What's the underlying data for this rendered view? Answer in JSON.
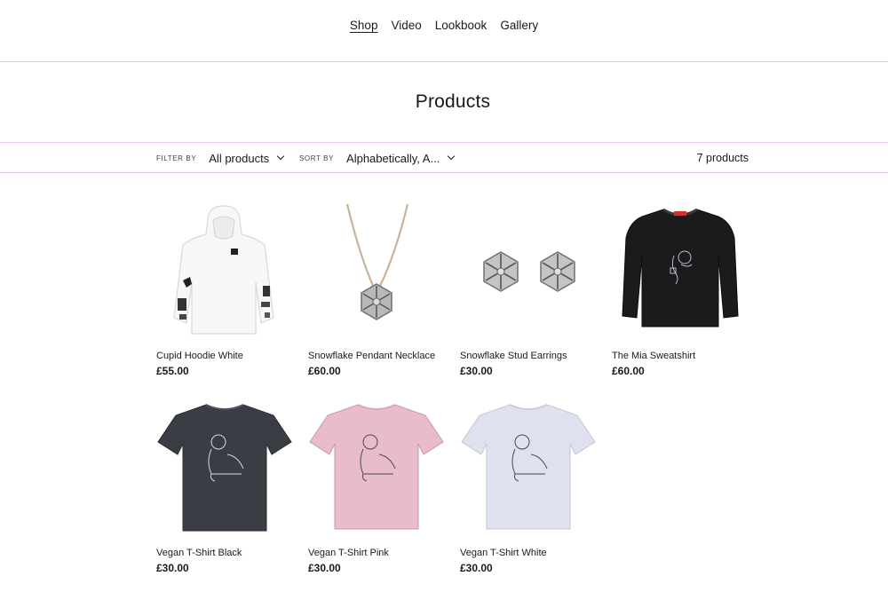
{
  "nav": {
    "items": [
      {
        "label": "Shop",
        "active": true
      },
      {
        "label": "Video",
        "active": false
      },
      {
        "label": "Lookbook",
        "active": false
      },
      {
        "label": "Gallery",
        "active": false
      }
    ]
  },
  "page_title": "Products",
  "filter": {
    "label": "Filter by",
    "value": "All products",
    "icon": "chevron-down-icon"
  },
  "sort": {
    "label": "Sort by",
    "value": "Alphabetically, A...",
    "icon": "chevron-down-icon"
  },
  "product_count": "7 products",
  "colors": {
    "divider": "#e6c8ec",
    "text": "#1a1a1a"
  },
  "products": [
    {
      "title": "Cupid Hoodie White",
      "price": "£55.00",
      "image": "white-hoodie"
    },
    {
      "title": "Snowflake Pendant Necklace",
      "price": "£60.00",
      "image": "snowflake-necklace"
    },
    {
      "title": "Snowflake Stud Earrings",
      "price": "£30.00",
      "image": "snowflake-earrings"
    },
    {
      "title": "The Mia Sweatshirt",
      "price": "£60.00",
      "image": "black-sweatshirt"
    },
    {
      "title": "Vegan T-Shirt Black",
      "price": "£30.00",
      "image": "black-tshirt"
    },
    {
      "title": "Vegan T-Shirt Pink",
      "price": "£30.00",
      "image": "pink-tshirt"
    },
    {
      "title": "Vegan T-Shirt White",
      "price": "£30.00",
      "image": "white-tshirt"
    }
  ]
}
